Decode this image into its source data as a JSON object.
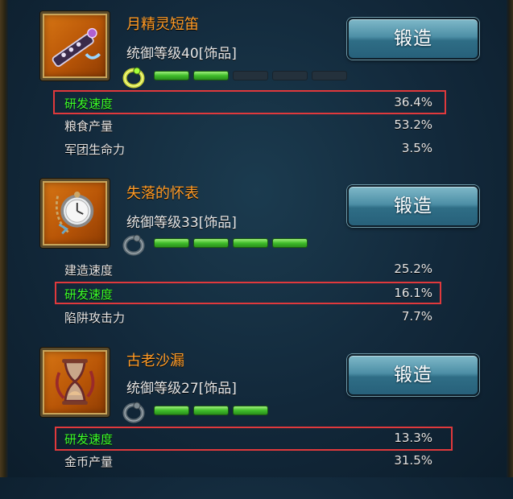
{
  "forge_label": "锻造",
  "items": [
    {
      "name": "月精灵短笛",
      "level_text": "统御等级40[饰品]",
      "icon": "flute-icon",
      "ring_icon": "gold-ring-icon",
      "bars_filled": 2,
      "bars_total": 5,
      "stats": [
        {
          "label": "研发速度",
          "value": "36.4%",
          "highlight": true
        },
        {
          "label": "粮食产量",
          "value": "53.2%",
          "highlight": false
        },
        {
          "label": "军团生命力",
          "value": "3.5%",
          "highlight": false
        }
      ]
    },
    {
      "name": "失落的怀表",
      "level_text": "统御等级33[饰品]",
      "icon": "pocket-watch-icon",
      "ring_icon": "grey-ring-icon",
      "bars_filled": 4,
      "bars_total": 4,
      "stats": [
        {
          "label": "建造速度",
          "value": "25.2%",
          "highlight": false
        },
        {
          "label": "研发速度",
          "value": "16.1%",
          "highlight": true
        },
        {
          "label": "陷阱攻击力",
          "value": "7.7%",
          "highlight": false
        }
      ]
    },
    {
      "name": "古老沙漏",
      "level_text": "统御等级27[饰品]",
      "icon": "hourglass-icon",
      "ring_icon": "grey-ring-icon",
      "bars_filled": 3,
      "bars_total": 3,
      "stats": [
        {
          "label": "研发速度",
          "value": "13.3%",
          "highlight": true
        },
        {
          "label": "金币产量",
          "value": "31.5%",
          "highlight": false
        }
      ]
    }
  ],
  "colors": {
    "item_name": "#ff9b26",
    "highlight_stat": "#3cff2a",
    "highlight_box": "#e0393c",
    "bar_on": "#3fbc2a"
  }
}
